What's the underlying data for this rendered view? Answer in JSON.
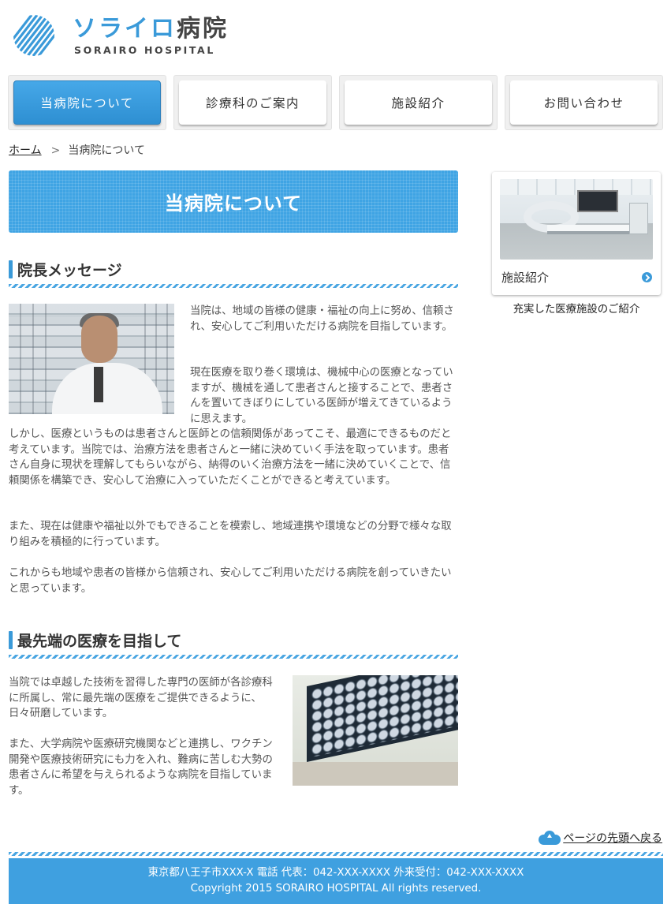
{
  "header": {
    "logo_jp_main": "ソライロ",
    "logo_jp_sub": "病院",
    "logo_en": "SORAIRO HOSPITAL"
  },
  "nav": [
    {
      "label": "当病院について",
      "active": true
    },
    {
      "label": "診療科のご案内",
      "active": false
    },
    {
      "label": "施設紹介",
      "active": false
    },
    {
      "label": "お問い合わせ",
      "active": false
    }
  ],
  "breadcrumb": {
    "home": "ホーム",
    "separator": ">",
    "current": "当病院について"
  },
  "page_title": "当病院について",
  "section1": {
    "heading": "院長メッセージ",
    "para1": "当院は、地域の皆様の健康・福祉の向上に努め、信頼され、安心してご利用いただける病院を目指しています。",
    "para2": "現在医療を取り巻く環境は、機械中心の医療となっていますが、機械を通して患者さんと接することで、患者さんを置いてきぼりにしている医師が増えてきているように思えます。",
    "para3": "しかし、医療というものは患者さんと医師との信頼関係があってこそ、最適にできるものだと考えています。当院では、治療方法を患者さんと一緒に決めていく手法を取っています。患者さん自身に現状を理解してもらいながら、納得のいく治療方法を一緒に決めていくことで、信頼関係を構築でき、安心して治療に入っていただくことができると考えています。",
    "para4": "また、現在は健康や福祉以外でもできることを模索し、地域連携や環境などの分野で様々な取り組みを積極的に行っています。",
    "para5": "これからも地域や患者の皆様から信頼され、安心してご利用いただける病院を創っていきたいと思っています。"
  },
  "section2": {
    "heading": "最先端の医療を目指して",
    "para1": "当院では卓越した技術を習得した専門の医師が各診療科に所属し、常に最先端の医療をご提供できるように、日々研磨しています。",
    "para2": "また、大学病院や医療研究機関などと連携し、ワクチン開発や医療技術研究にも力を入れ、難病に苦しむ大勢の患者さんに希望を与えられるような病院を目指しています。"
  },
  "sidebar": {
    "card_label": "施設紹介",
    "caption": "充実した医療施設のご紹介"
  },
  "pagetop": {
    "label": "ページの先頭へ戻る"
  },
  "footer": {
    "address": "東京都八王子市XXX-X 電話 代表：042-XXX-XXXX 外来受付：042-XXX-XXXX",
    "copyright": "Copyright 2015 SORAIRO HOSPITAL All rights reserved."
  },
  "colors": {
    "accent": "#3a9ad9",
    "banner": "#3fa4e4",
    "footer": "#3fa0e0"
  }
}
